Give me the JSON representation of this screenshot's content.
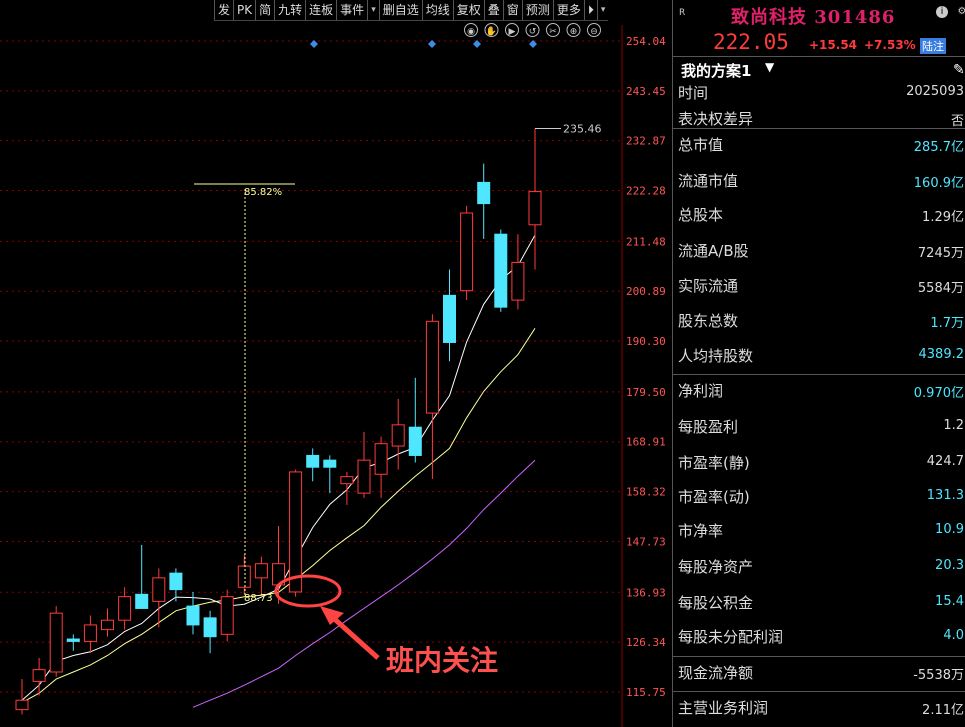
{
  "toolbar": {
    "items": [
      "发",
      "PK",
      "简",
      "九转",
      "连板",
      "事件",
      "▾",
      "删自选",
      "均线",
      "复权",
      "叠",
      "窗",
      "预测",
      "更多",
      "⏵",
      "▾"
    ]
  },
  "chart_icons": [
    "eye-icon",
    "hand-icon",
    "play-icon",
    "undo-icon",
    "scissors-icon",
    "zoom-in-icon",
    "zoom-out-icon"
  ],
  "chart_data": {
    "type": "candlestick",
    "y_ticks": [
      "254.04",
      "243.45",
      "232.87",
      "222.28",
      "211.48",
      "200.89",
      "190.30",
      "179.50",
      "168.91",
      "158.32",
      "147.73",
      "136.93",
      "126.34",
      "115.75"
    ],
    "ylim": [
      115.75,
      254.04
    ],
    "candles": [
      {
        "o": 112.0,
        "h": 118.5,
        "l": 111.0,
        "c": 114.0
      },
      {
        "o": 118.0,
        "h": 123.0,
        "l": 115.0,
        "c": 120.5
      },
      {
        "o": 120.0,
        "h": 134.0,
        "l": 119.0,
        "c": 132.5
      },
      {
        "o": 127.0,
        "h": 128.0,
        "l": 124.5,
        "c": 126.5
      },
      {
        "o": 126.5,
        "h": 132.0,
        "l": 124.0,
        "c": 130.0
      },
      {
        "o": 129.0,
        "h": 133.5,
        "l": 127.5,
        "c": 131.0
      },
      {
        "o": 131.0,
        "h": 138.0,
        "l": 129.0,
        "c": 136.0
      },
      {
        "o": 136.5,
        "h": 147.0,
        "l": 134.0,
        "c": 133.5
      },
      {
        "o": 135.0,
        "h": 142.0,
        "l": 129.5,
        "c": 140.0
      },
      {
        "o": 141.0,
        "h": 142.0,
        "l": 135.0,
        "c": 137.5
      },
      {
        "o": 134.0,
        "h": 137.0,
        "l": 128.0,
        "c": 130.0
      },
      {
        "o": 131.5,
        "h": 133.0,
        "l": 124.0,
        "c": 127.5
      },
      {
        "o": 128.0,
        "h": 137.5,
        "l": 126.5,
        "c": 136.0
      },
      {
        "o": 138.0,
        "h": 145.0,
        "l": 136.5,
        "c": 142.5
      },
      {
        "o": 140.0,
        "h": 144.5,
        "l": 136.5,
        "c": 143.0
      },
      {
        "o": 138.5,
        "h": 151.0,
        "l": 134.5,
        "c": 143.0
      },
      {
        "o": 137.0,
        "h": 163.0,
        "l": 136.0,
        "c": 162.5
      },
      {
        "o": 166.0,
        "h": 167.5,
        "l": 160.5,
        "c": 163.5
      },
      {
        "o": 165.0,
        "h": 166.0,
        "l": 158.0,
        "c": 163.5
      },
      {
        "o": 160.0,
        "h": 162.5,
        "l": 155.5,
        "c": 161.5
      },
      {
        "o": 158.0,
        "h": 171.0,
        "l": 157.0,
        "c": 165.0
      },
      {
        "o": 162.0,
        "h": 170.0,
        "l": 157.0,
        "c": 168.5
      },
      {
        "o": 168.0,
        "h": 178.0,
        "l": 163.0,
        "c": 172.5
      },
      {
        "o": 172.0,
        "h": 182.5,
        "l": 164.5,
        "c": 166.0
      },
      {
        "o": 175.0,
        "h": 196.0,
        "l": 161.0,
        "c": 194.5
      },
      {
        "o": 200.0,
        "h": 205.5,
        "l": 186.0,
        "c": 190.0
      },
      {
        "o": 201.0,
        "h": 219.0,
        "l": 199.0,
        "c": 217.5
      },
      {
        "o": 224.0,
        "h": 228.0,
        "l": 212.0,
        "c": 219.5
      },
      {
        "o": 213.0,
        "h": 214.0,
        "l": 196.5,
        "c": 197.5
      },
      {
        "o": 199.0,
        "h": 213.0,
        "l": 197.0,
        "c": 207.0
      },
      {
        "o": 215.0,
        "h": 235.46,
        "l": 205.5,
        "c": 222.05
      }
    ],
    "ma_series": [
      {
        "color": "#ffffff",
        "values": [
          114.0,
          117.2,
          122.3,
          123.5,
          124.3,
          125.8,
          128.6,
          130.3,
          133.5,
          135.9,
          135.8,
          135.5,
          134.0,
          134.4,
          135.9,
          137.6,
          144.1,
          150.7,
          155.6,
          158.7,
          163.4,
          164.5,
          166.3,
          167.7,
          173.5,
          178.7,
          190.1,
          198.1,
          203.3,
          206.3,
          212.8
        ]
      },
      {
        "color": "#ffff99",
        "values": [
          113.5,
          115.5,
          118.5,
          120.0,
          121.5,
          123.5,
          126.0,
          128.0,
          130.5,
          133.0,
          134.0,
          134.8,
          135.3,
          136.0,
          136.3,
          136.9,
          139.7,
          142.6,
          145.8,
          148.5,
          151.1,
          155.0,
          158.4,
          161.6,
          164.5,
          167.5,
          174.0,
          179.6,
          183.8,
          187.4,
          193.0
        ]
      },
      {
        "color": "#cc66ff",
        "values": [
          null,
          null,
          null,
          null,
          null,
          null,
          null,
          null,
          null,
          null,
          112.5,
          114.0,
          115.5,
          117.2,
          119.0,
          120.8,
          123.5,
          126.0,
          128.4,
          131.0,
          133.5,
          136.0,
          138.5,
          141.2,
          144.0,
          147.0,
          150.5,
          154.5,
          158.0,
          161.6,
          165.0
        ]
      }
    ],
    "annotations": {
      "high_label": "235.46",
      "pct_label": "85.82%",
      "low_label": "88.73",
      "callout_text": "班内关注"
    }
  },
  "quote": {
    "badge": "R",
    "title": "致尚科技 301486",
    "price": "222.05",
    "change": "+15.54",
    "change_pct": "+7.53%",
    "tag": "陆注"
  },
  "scheme": {
    "label": "我的方案1"
  },
  "fields": [
    {
      "label": "时间",
      "value": "2025093",
      "color": "white"
    },
    {
      "label": "表决权差异",
      "value": "否",
      "color": "white"
    },
    {
      "label": "总市值",
      "value": "285.7亿",
      "color": "cyan"
    },
    {
      "label": "流通市值",
      "value": "160.9亿",
      "color": "cyan"
    },
    {
      "label": "总股本",
      "value": "1.29亿",
      "color": "white"
    },
    {
      "label": "流通A/B股",
      "value": "7245万",
      "color": "white"
    },
    {
      "label": "实际流通",
      "value": "5584万",
      "color": "white"
    },
    {
      "label": "股东总数",
      "value": "1.7万",
      "color": "cyan"
    },
    {
      "label": "人均持股数",
      "value": "4389.2",
      "color": "cyan"
    },
    {
      "label": "净利润",
      "value": "0.970亿",
      "color": "cyan"
    },
    {
      "label": "每股盈利",
      "value": "1.2",
      "color": "white"
    },
    {
      "label": "市盈率(静)",
      "value": "424.7",
      "color": "white"
    },
    {
      "label": "市盈率(动)",
      "value": "131.3",
      "color": "cyan"
    },
    {
      "label": "市净率",
      "value": "10.9",
      "color": "cyan"
    },
    {
      "label": "每股净资产",
      "value": "20.3",
      "color": "cyan"
    },
    {
      "label": "每股公积金",
      "value": "15.4",
      "color": "cyan"
    },
    {
      "label": "每股未分配利润",
      "value": "4.0",
      "color": "cyan"
    },
    {
      "label": "现金流净额",
      "value": "-5538万",
      "color": "white"
    },
    {
      "label": "主营业务利润",
      "value": "2.11亿",
      "color": "white"
    }
  ]
}
